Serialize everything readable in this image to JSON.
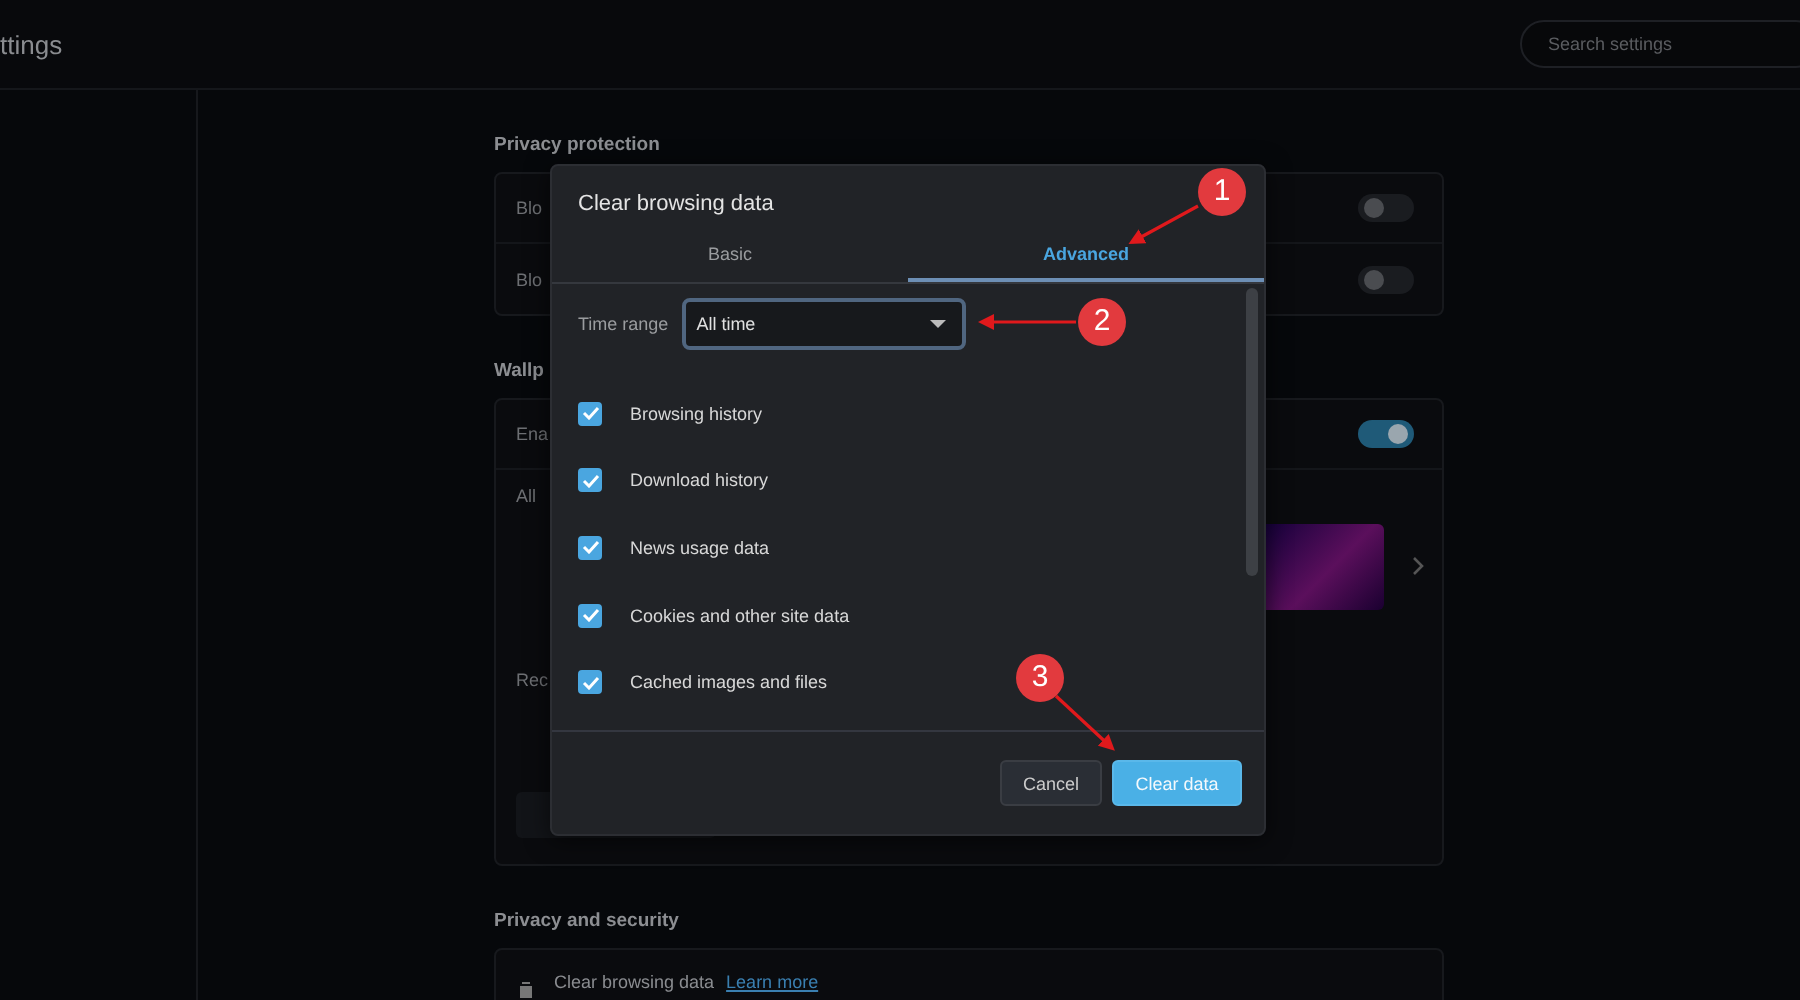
{
  "header": {
    "title": "ttings",
    "search": {
      "placeholder": "Search settings"
    }
  },
  "sections": [
    {
      "title": "Privacy protection",
      "rows": [
        {
          "kind": "toggle",
          "label": "Blo",
          "on": false
        },
        {
          "kind": "toggle",
          "label": "Blo",
          "on": false
        }
      ]
    },
    {
      "title": "Wallp",
      "rows": [
        {
          "kind": "toggle",
          "label": "Ena",
          "on": true
        },
        {
          "kind": "gallery",
          "label": "All"
        },
        {
          "kind": "text",
          "label": "Rec"
        },
        {
          "kind": "button"
        }
      ]
    },
    {
      "title": "Privacy and security",
      "rows": [
        {
          "kind": "link",
          "label": "Clear browsing data",
          "link": "Learn more"
        }
      ]
    }
  ],
  "dialog": {
    "title": "Clear browsing data",
    "tabs": [
      {
        "label": "Basic",
        "selected": false
      },
      {
        "label": "Advanced",
        "selected": true
      }
    ],
    "time_range": {
      "label": "Time range",
      "value": "All time"
    },
    "items": [
      {
        "label": "Browsing history",
        "checked": true
      },
      {
        "label": "Download history",
        "checked": true
      },
      {
        "label": "News usage data",
        "checked": true
      },
      {
        "label": "Cookies and other site data",
        "checked": true
      },
      {
        "label": "Cached images and files",
        "checked": true
      }
    ],
    "buttons": [
      {
        "label": "Cancel",
        "kind": "secondary"
      },
      {
        "label": "Clear data",
        "kind": "primary"
      }
    ]
  },
  "annotations": [
    {
      "label": "1"
    },
    {
      "label": "2"
    },
    {
      "label": "3"
    }
  ]
}
